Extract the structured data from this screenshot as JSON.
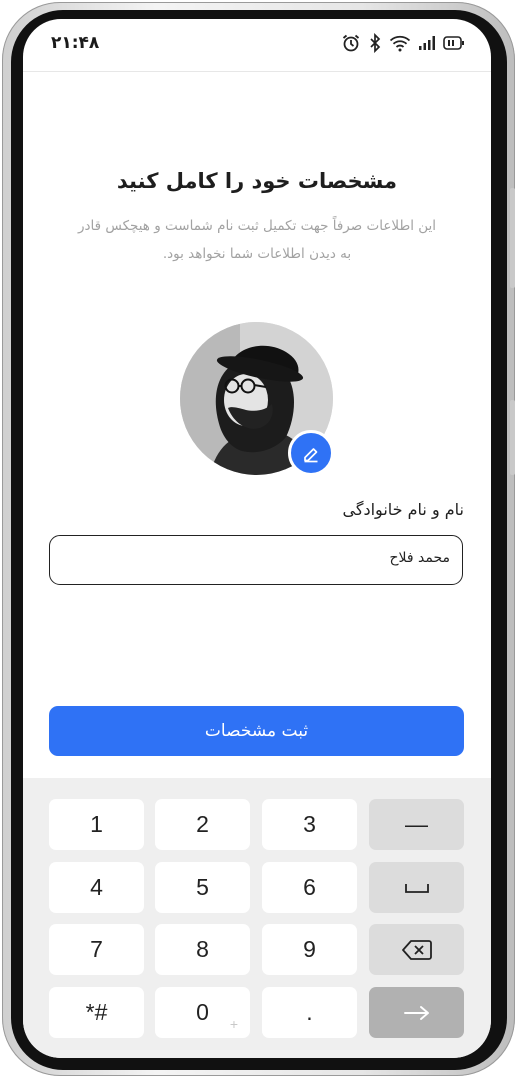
{
  "status_bar": {
    "time": "۲۱:۴۸"
  },
  "header": {
    "title": "مشخصات خود را کامل کنید",
    "subtitle_line1": "این اطلاعات صرفاً جهت تکمیل ثبت نام شماست و هیچکس قادر",
    "subtitle_line2": "به دیدن اطلاعات شما نخواهد بود."
  },
  "form": {
    "name_label": "نام و نام خانوادگی",
    "name_value": "محمد فلاح"
  },
  "submit_label": "ثبت مشخصات",
  "keyboard": {
    "row1": [
      "1",
      "2",
      "3",
      "—"
    ],
    "row2": [
      "4",
      "5",
      "6"
    ],
    "row3": [
      "7",
      "8",
      "9"
    ],
    "row4": [
      "*#",
      "0",
      "."
    ],
    "zero_hint": "+"
  },
  "colors": {
    "accent": "#2f72f5"
  },
  "icons": [
    "alarm-icon",
    "bluetooth-icon",
    "wifi-icon",
    "signal-icon",
    "battery-icon",
    "edit-icon",
    "space-icon",
    "backspace-icon",
    "arrow-right-icon"
  ]
}
